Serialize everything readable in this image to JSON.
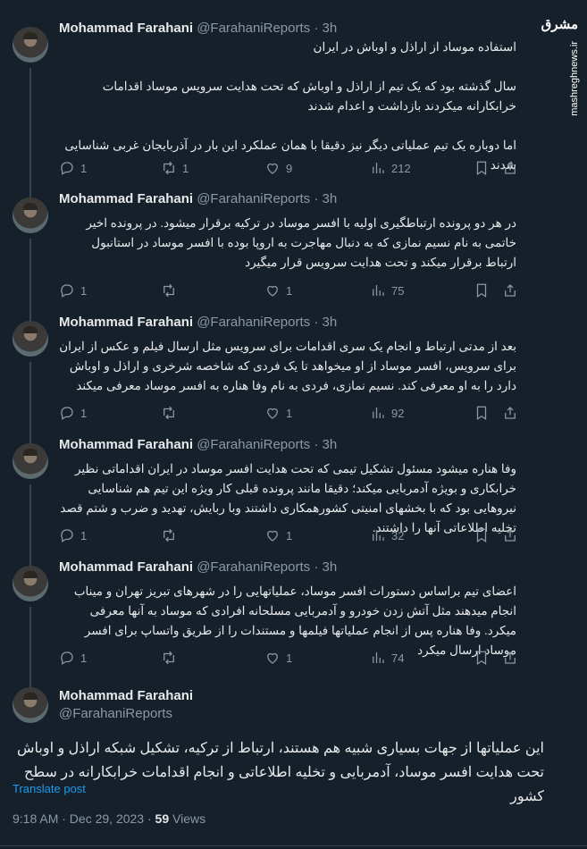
{
  "author": {
    "name": "Mohammad Farahani",
    "handle": "@FarahaniReports",
    "time": "3h"
  },
  "watermark": {
    "logo": "مشرق",
    "url": "mashreghnews.ir"
  },
  "tweets": [
    {
      "text": "استفاده موساد از اراذل و اوباش در ایران\n\nسال گذشته بود که یک تیم از اراذل و اوباش که تحت هدایت سرویس موساد اقدامات خرابکارانه میکردند بازداشت و اعدام شدند\n\nاما دوباره یک تیم عملیاتی دیگر نیز دقیقا با همان عملکرد این بار در آذربایجان غربی شناسایی شدند",
      "replies": "1",
      "retweets": "1",
      "likes": "9",
      "views": "212"
    },
    {
      "text": "در هر دو پرونده ارتباطگیری اولیه با افسر موساد در ترکیه برقرار میشود. در پرونده اخیر خاتمی به نام نسیم نمازی که به دنبال مهاجرت به اروپا بوده با افسر موساد در استانبول ارتباط برقرار میکند و تحت هدایت سرویس قرار میگیرد",
      "replies": "1",
      "retweets": "",
      "likes": "1",
      "views": "75"
    },
    {
      "text": "بعد از مدتی ارتباط و انجام یک سری اقدامات برای سرویس مثل ارسال فیلم و عکس از ایران برای سرویس، افسر موساد از او میخواهد تا یک فردی که شاخصه شرخری و اراذل و اوباش دارد را به او معرفی کند. نسیم نمازی، فردی به نام وفا هناره به افسر موساد معرفی میکند",
      "replies": "1",
      "retweets": "",
      "likes": "1",
      "views": "92"
    },
    {
      "text": "وفا هناره میشود مسئول تشکیل تیمی که تحت هدایت افسر موساد در ایران اقداماتی نظیر خرابکاری و بویژه آدمربایی میکند؛ دقیقا مانند پرونده قبلی کار ویژه این تیم هم شناسایی نیروهایی بود که با بخشهای امنیتی کشورهمکاری داشتند وبا ربایش، تهدید و ضرب و شتم قصد تخلیه اطلاعاتی آنها را داشتند.",
      "replies": "1",
      "retweets": "",
      "likes": "1",
      "views": "32"
    },
    {
      "text": "اعضای تیم براساس دستورات افسر موساد، عملیاتهایی را در شهرهای تبریز تهران و میناب انجام میدهند مثل آتش زدن خودرو و آدمربایی مسلحانه افرادی که موساد به آنها معرفی میکرد. وفا هناره پس از انجام عملیاتها فیلمها و مستندات را از طریق واتساپ برای افسر موساد ارسال میکرد",
      "replies": "1",
      "retweets": "",
      "likes": "1",
      "views": "74"
    }
  ],
  "main_tweet": {
    "text": "این عملیاتها از جهات بسیاری شبیه هم هستند، ارتباط از ترکیه، تشکیل شبکه اراذل و اوباش تحت هدایت افسر موساد، آدمربایی و تخلیه اطلاعاتی و انجام اقدامات خرابکارانه در سطح کشور",
    "translate_label": "Translate post",
    "time": "9:18 AM · Dec 29, 2023 ·",
    "views_count": "59",
    "views_label": "Views"
  }
}
